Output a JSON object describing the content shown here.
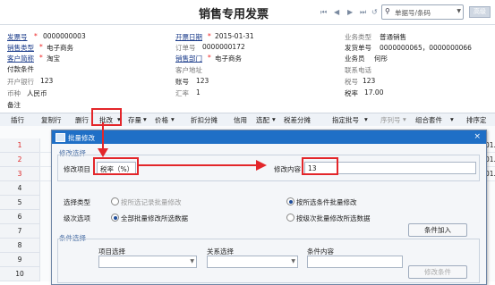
{
  "window": {
    "title": "销售专用发票",
    "nav": [
      "⏮",
      "◀",
      "▶",
      "⏭",
      "↺"
    ],
    "search_placeholder": "单据号/条码",
    "top_button": "高级"
  },
  "header": {
    "invoice_no_label": "发票号",
    "invoice_no": "0000000003",
    "date_label": "开票日期",
    "date": "2015-01-31",
    "biz_type_label": "业务类型",
    "biz_type": "普通销售",
    "sales_type_label": "销售类型",
    "sales_type": "电子商务",
    "order_no_label": "订单号",
    "order_no": "0000000172",
    "ship_no_label": "发货单号",
    "ship_no": "0000000065，0000000066",
    "customer_label": "客户简称",
    "customer": "淘宝",
    "dept_label": "销售部门",
    "dept": "电子商务",
    "salesman_label": "业务员",
    "salesman": "何彤",
    "pay_terms_label": "付款条件",
    "cust_addr_label": "客户地址",
    "contact_tel_label": "联系电话",
    "bank_label": "开户银行",
    "bank": "123",
    "account_label": "账号",
    "account": "123",
    "tax_no_label": "税号",
    "tax_no": "123",
    "currency_label": "币种",
    "currency": "人民币",
    "rate_label": "汇率",
    "rate": "1",
    "tax_rate_label": "税率",
    "tax_rate": "17.00",
    "remark_label": "备注"
  },
  "toolbar": {
    "items": [
      "插行",
      "复制行",
      "删行",
      "批改",
      "存量",
      "价格",
      "折扣分摊",
      "信用",
      "选配",
      "税差分摊",
      "指定批号",
      "序列号",
      "组合套件",
      "排序定"
    ]
  },
  "grid": {
    "rows": [
      "1",
      "2",
      "3",
      "4",
      "5",
      "6",
      "7",
      "8",
      "9",
      "10"
    ],
    "right_values": [
      "01.",
      "01.",
      "01."
    ]
  },
  "dialog": {
    "title": "批量修改",
    "close": "×",
    "section_modify": "修改选择",
    "item_label": "修改项目",
    "item_value": "税率（%）",
    "content_label": "修改内容",
    "content_value": "13",
    "select_type_label": "选择类型",
    "opt_selected_rows": "按所选记录批量修改",
    "opt_by_condition": "按所选条件批量修改",
    "level_label": "级次选项",
    "opt_all_levels": "全部批量修改所选数据",
    "opt_by_level": "按级次批量修改所选数据",
    "section_condition": "条件选择",
    "cond_item_label": "项目选择",
    "cond_relation_label": "关系选择",
    "cond_content_label": "条件内容",
    "add_condition": "条件加入",
    "modify_condition": "修改条件"
  }
}
